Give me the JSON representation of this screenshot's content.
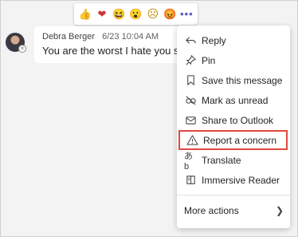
{
  "reactions": [
    {
      "name": "like",
      "glyph": "👍"
    },
    {
      "name": "heart",
      "glyph": "❤"
    },
    {
      "name": "laugh",
      "glyph": "😆"
    },
    {
      "name": "surprised",
      "glyph": "😮"
    },
    {
      "name": "sad",
      "glyph": "☹"
    },
    {
      "name": "angry",
      "glyph": "😡"
    }
  ],
  "more_dots": "•••",
  "message": {
    "author": "Debra Berger",
    "timestamp": "6/23 10:04 AM",
    "text": "You are the worst I hate you so mu"
  },
  "menu": {
    "items": [
      {
        "label": "Reply",
        "icon": "reply-icon"
      },
      {
        "label": "Pin",
        "icon": "pin-icon"
      },
      {
        "label": "Save this message",
        "icon": "bookmark-icon"
      },
      {
        "label": "Mark as unread",
        "icon": "unread-icon"
      },
      {
        "label": "Share to Outlook",
        "icon": "mail-icon"
      },
      {
        "label": "Report a concern",
        "icon": "warning-icon"
      },
      {
        "label": "Translate",
        "icon": "translate-icon"
      },
      {
        "label": "Immersive Reader",
        "icon": "immersive-reader-icon"
      }
    ],
    "more_actions": "More actions",
    "highlight_color": "#e0483f"
  }
}
